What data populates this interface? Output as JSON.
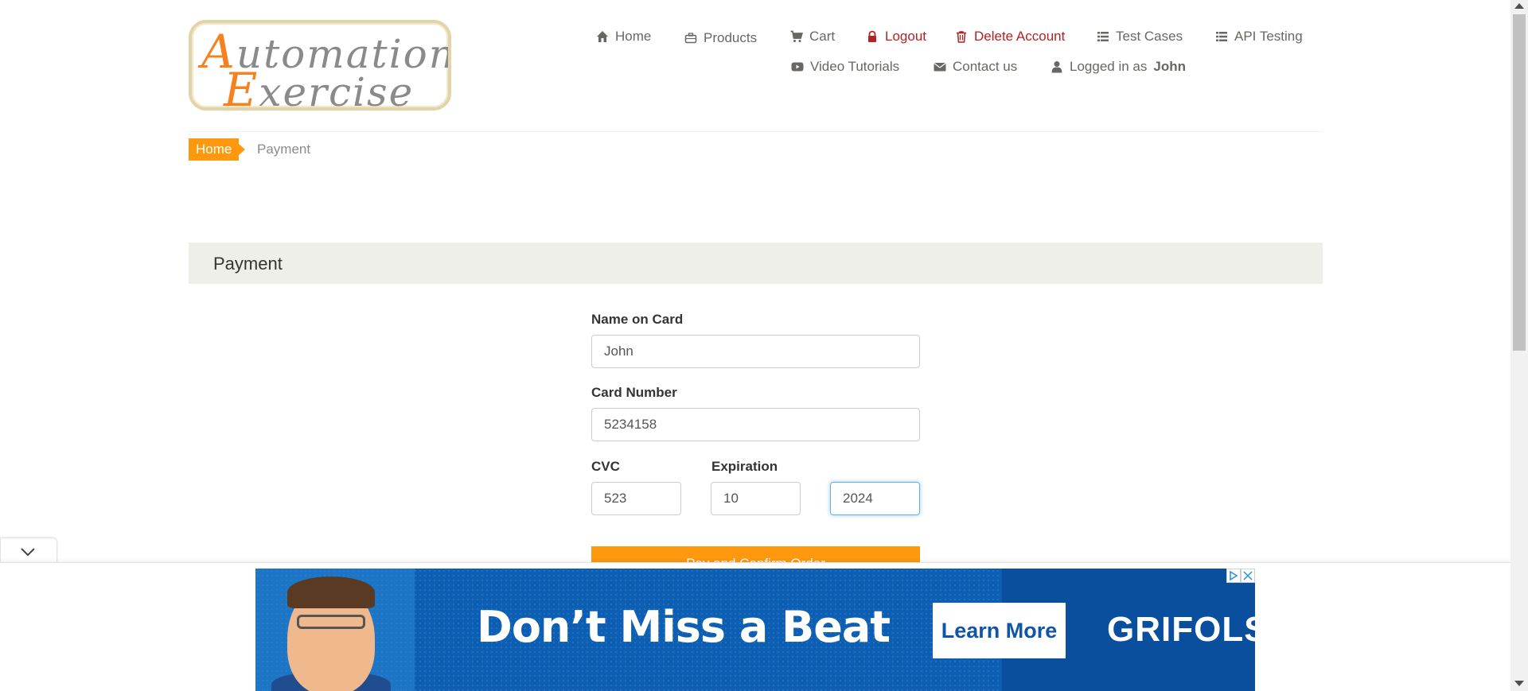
{
  "logo": {
    "line1_big": "A",
    "line1_rest": "utomation",
    "line2_big": "E",
    "line2_rest": "xercise"
  },
  "nav": {
    "home": "Home",
    "products": "Products",
    "cart": "Cart",
    "logout": "Logout",
    "delete_account": "Delete Account",
    "test_cases": "Test Cases",
    "api_testing": "API Testing",
    "video_tutorials": "Video Tutorials",
    "contact_us": "Contact us",
    "logged_in_prefix": "Logged in as",
    "logged_in_user": "John"
  },
  "breadcrumb": {
    "home": "Home",
    "current": "Payment"
  },
  "payment": {
    "heading": "Payment",
    "name_label": "Name on Card",
    "name_value": "John",
    "card_label": "Card Number",
    "card_value": "5234158",
    "cvc_label": "CVC",
    "cvc_value": "523",
    "expiration_label": "Expiration",
    "exp_month_value": "10",
    "exp_year_value": "2024",
    "submit_label": "Pay and Confirm Order"
  },
  "ad": {
    "headline": "Don’t Miss a Beat",
    "cta": "Learn More",
    "brand": "GRIFOLS"
  },
  "colors": {
    "accent": "#fe980f",
    "danger": "#b22222",
    "ad_blue": "#0d5fb3",
    "heading_bg": "#efefea"
  }
}
